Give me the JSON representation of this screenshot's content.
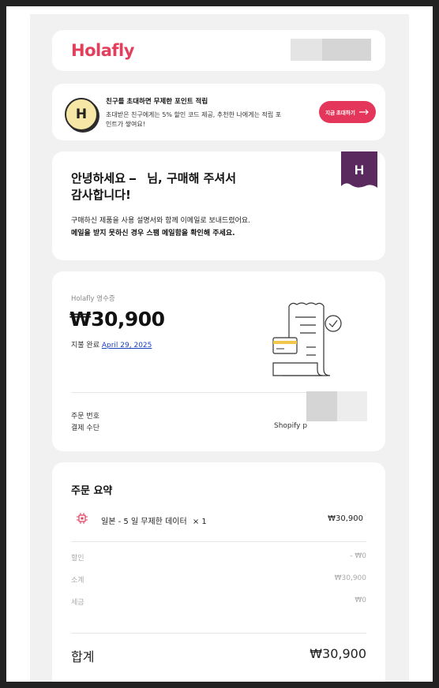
{
  "header": {
    "logo_text": "Holafly",
    "brand_color": "#e33e5c"
  },
  "referral": {
    "badge_letter": "H",
    "title": "친구를 초대하면 무제한 포인트 적립",
    "description": "초대받은 친구에게는 5% 할인 코드 제공, 추천한 나에게는 적립 포인트가 쌓여요!",
    "button_label": "지금 초대하기",
    "button_icon": "arrow-right-icon",
    "button_color": "#e3365a"
  },
  "greeting": {
    "hello_before": "안녕하세요",
    "hello_after": "님, 구매해 주셔서",
    "hello_line2": "감사합니다!",
    "body": "구매하신 제품을 사용 설명서와 함께 이메일로 보내드렸어요.",
    "notice": "메일을 받지 못하신 경우 스팸 메일함을 확인해 주세요.",
    "flag_letter": "H",
    "flag_color": "#5a2a5e"
  },
  "receipt": {
    "label": "Holafly 영수증",
    "amount": "₩30,900",
    "paid_label": "지불 완료",
    "paid_date": "April 29, 2025",
    "order_number_label": "주문 번호",
    "payment_method_label": "결제 수단",
    "payment_method_value": "Shopify p"
  },
  "summary": {
    "title": "주문 요약",
    "item_icon": "chip-icon",
    "item_name": "일본 - 5 일 무제한 데이터",
    "item_qty": "× 1",
    "item_price": "₩30,900",
    "discount_label": "할인",
    "discount_value": "- ₩0",
    "subtotal_label": "소계",
    "subtotal_value": "₩30,900",
    "tax_label": "세금",
    "tax_value": "₩0",
    "total_label": "합계",
    "total_value": "₩30,900"
  }
}
